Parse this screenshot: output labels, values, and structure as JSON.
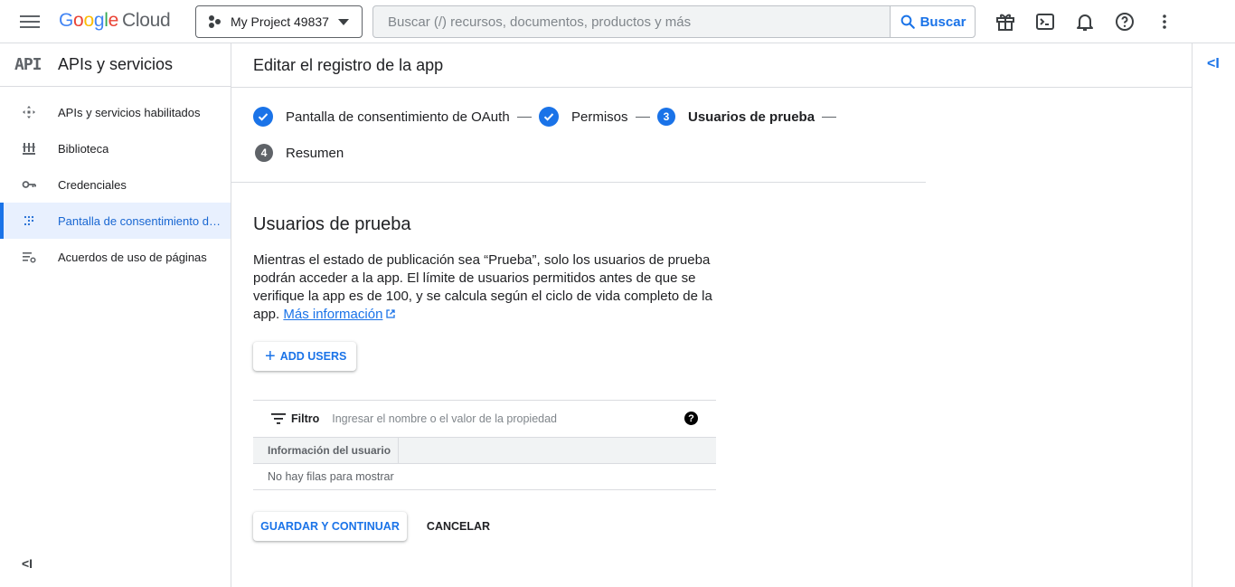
{
  "topbar": {
    "logo_parts": [
      "G",
      "o",
      "o",
      "g",
      "l",
      "e"
    ],
    "logo_suffix": "Cloud",
    "project_name": "My Project 49837",
    "search_placeholder": "Buscar (/) recursos, documentos, productos y más",
    "search_button": "Buscar",
    "icons": [
      "gift-icon",
      "terminal-icon",
      "bell-icon",
      "help-icon",
      "more-vert-icon"
    ]
  },
  "sidebar": {
    "badge": "API",
    "title": "APIs y servicios",
    "items": [
      {
        "label": "APIs y servicios habilitados",
        "icon": "apis-icon",
        "active": false
      },
      {
        "label": "Biblioteca",
        "icon": "library-icon",
        "active": false
      },
      {
        "label": "Credenciales",
        "icon": "key-icon",
        "active": false
      },
      {
        "label": "Pantalla de consentimiento de OAuth",
        "icon": "consent-grid-icon",
        "active": true
      },
      {
        "label": "Acuerdos de uso de páginas",
        "icon": "settings-list-icon",
        "active": false
      }
    ],
    "collapse": "<I"
  },
  "main": {
    "title": "Editar el registro de la app",
    "collapse_right": "<I",
    "steps": [
      {
        "number": "",
        "label": "Pantalla de consentimiento de OAuth",
        "state": "done"
      },
      {
        "number": "",
        "label": "Permisos",
        "state": "done"
      },
      {
        "number": "3",
        "label": "Usuarios de prueba",
        "state": "current"
      },
      {
        "number": "4",
        "label": "Resumen",
        "state": "todo"
      }
    ],
    "section_title": "Usuarios de prueba",
    "description": "Mientras el estado de publicación sea “Prueba”, solo los usuarios de prueba podrán acceder a la app. El límite de usuarios permitidos antes de que se verifique la app es de 100, y se calcula según el ciclo de vida completo de la app.",
    "learn_more": "Más información",
    "add_users": "ADD USERS",
    "filter_label": "Filtro",
    "filter_placeholder": "Ingresar el nombre o el valor de la propiedad",
    "table_header": "Información del usuario",
    "empty_text": "No hay filas para mostrar",
    "save_button": "GUARDAR Y CONTINUAR",
    "cancel_button": "CANCELAR"
  },
  "colors": {
    "accent": "#1a73e8",
    "active_bg": "#e8f0fe",
    "border": "#dadce0"
  }
}
